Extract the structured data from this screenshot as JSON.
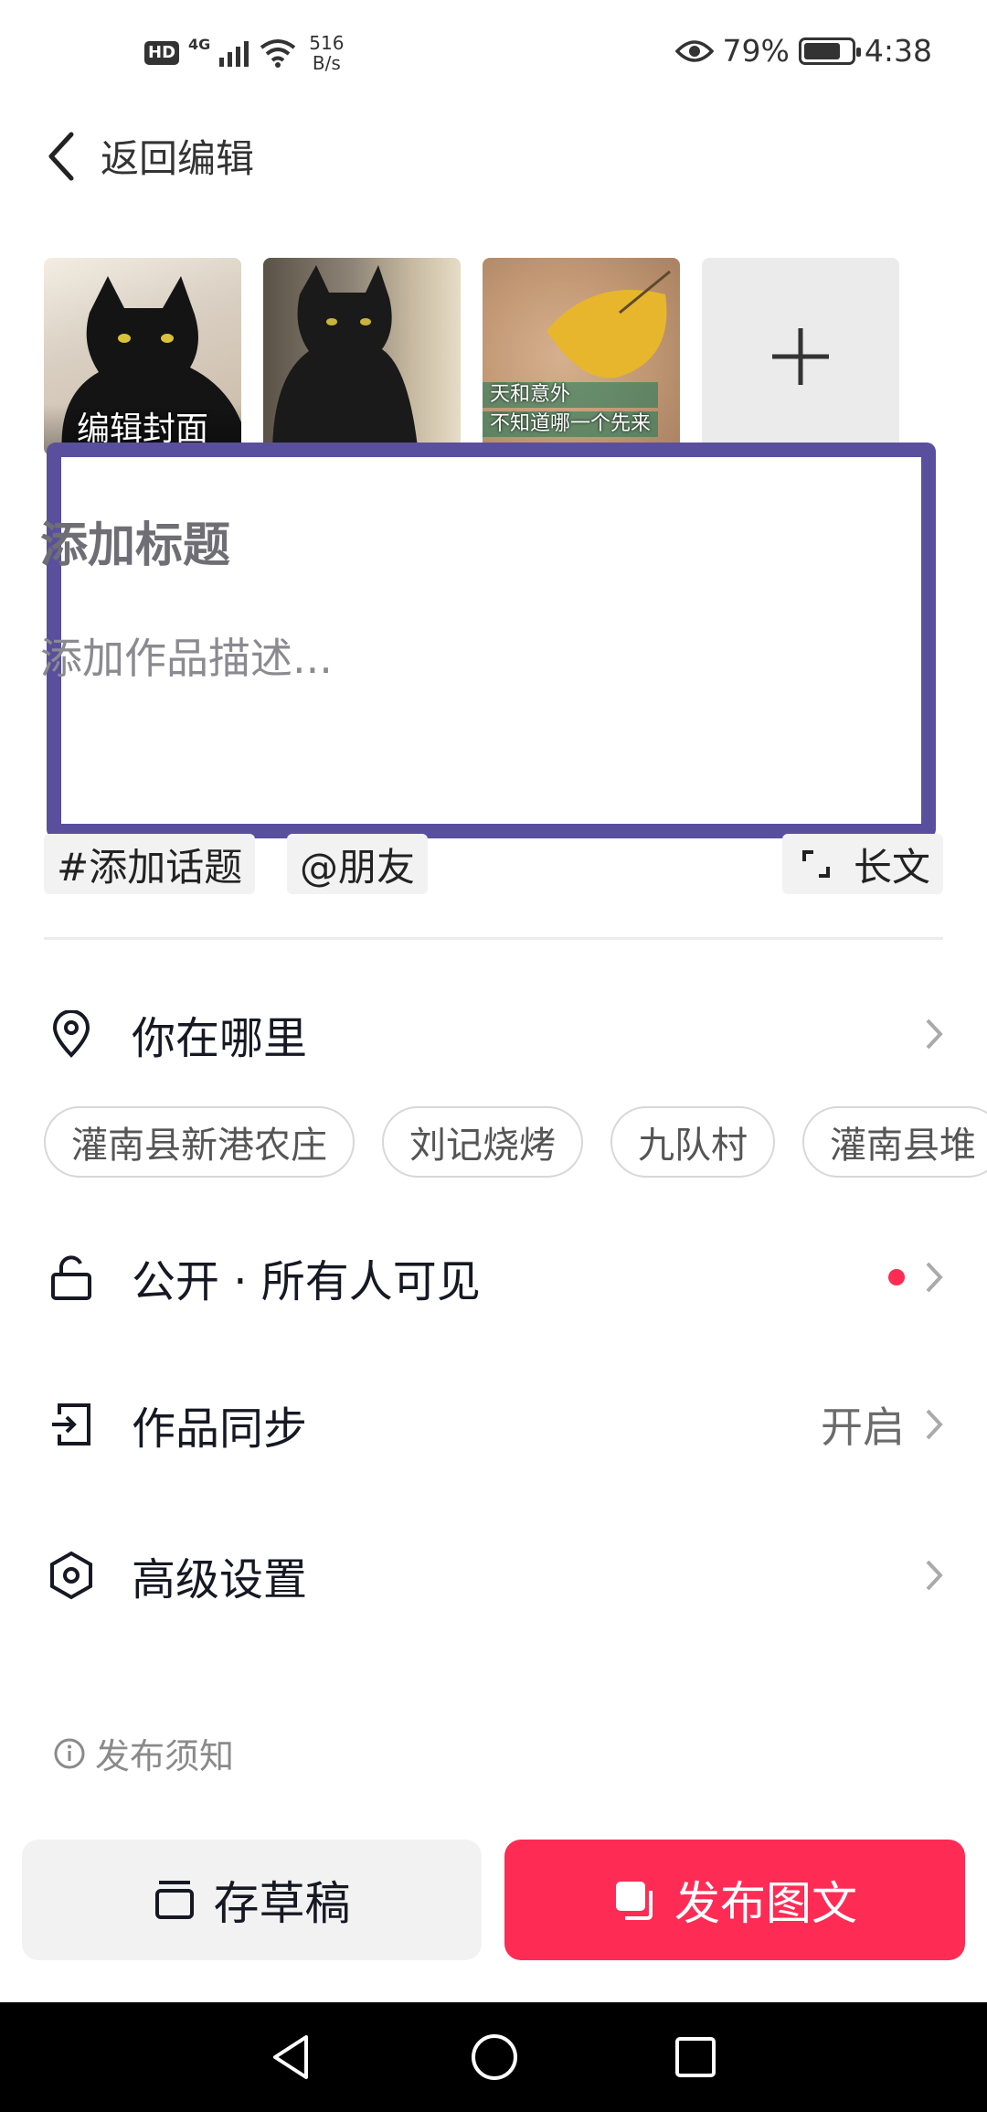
{
  "status_bar": {
    "hd": "HD",
    "network": "4G",
    "speed_value": "516",
    "speed_unit": "B/s",
    "battery_percent": "79%",
    "battery_level": 0.79,
    "time": "4:38"
  },
  "header": {
    "back_label": "返回编辑"
  },
  "media": {
    "cover_label": "编辑封面",
    "leaf_caption_line1": "天和意外",
    "leaf_caption_line2": "不知道哪一个先来"
  },
  "editor": {
    "title_placeholder": "添加标题",
    "description_placeholder": "添加作品描述..."
  },
  "chips": {
    "topic": "#添加话题",
    "friend": "@朋友",
    "long_text": "长文"
  },
  "location": {
    "label": "你在哪里",
    "suggestions": [
      "灌南县新港农庄",
      "刘记烧烤",
      "九队村",
      "灌南县堆"
    ]
  },
  "privacy": {
    "label": "公开 · 所有人可见"
  },
  "sync": {
    "label": "作品同步",
    "value": "开启"
  },
  "advanced": {
    "label": "高级设置"
  },
  "notice": {
    "label": "发布须知"
  },
  "actions": {
    "draft_label": "存草稿",
    "publish_label": "发布图文"
  },
  "colors": {
    "accent": "#fe2c55",
    "highlight_border": "#5a4f9d",
    "text": "#161823",
    "muted": "#8a8a8a"
  }
}
